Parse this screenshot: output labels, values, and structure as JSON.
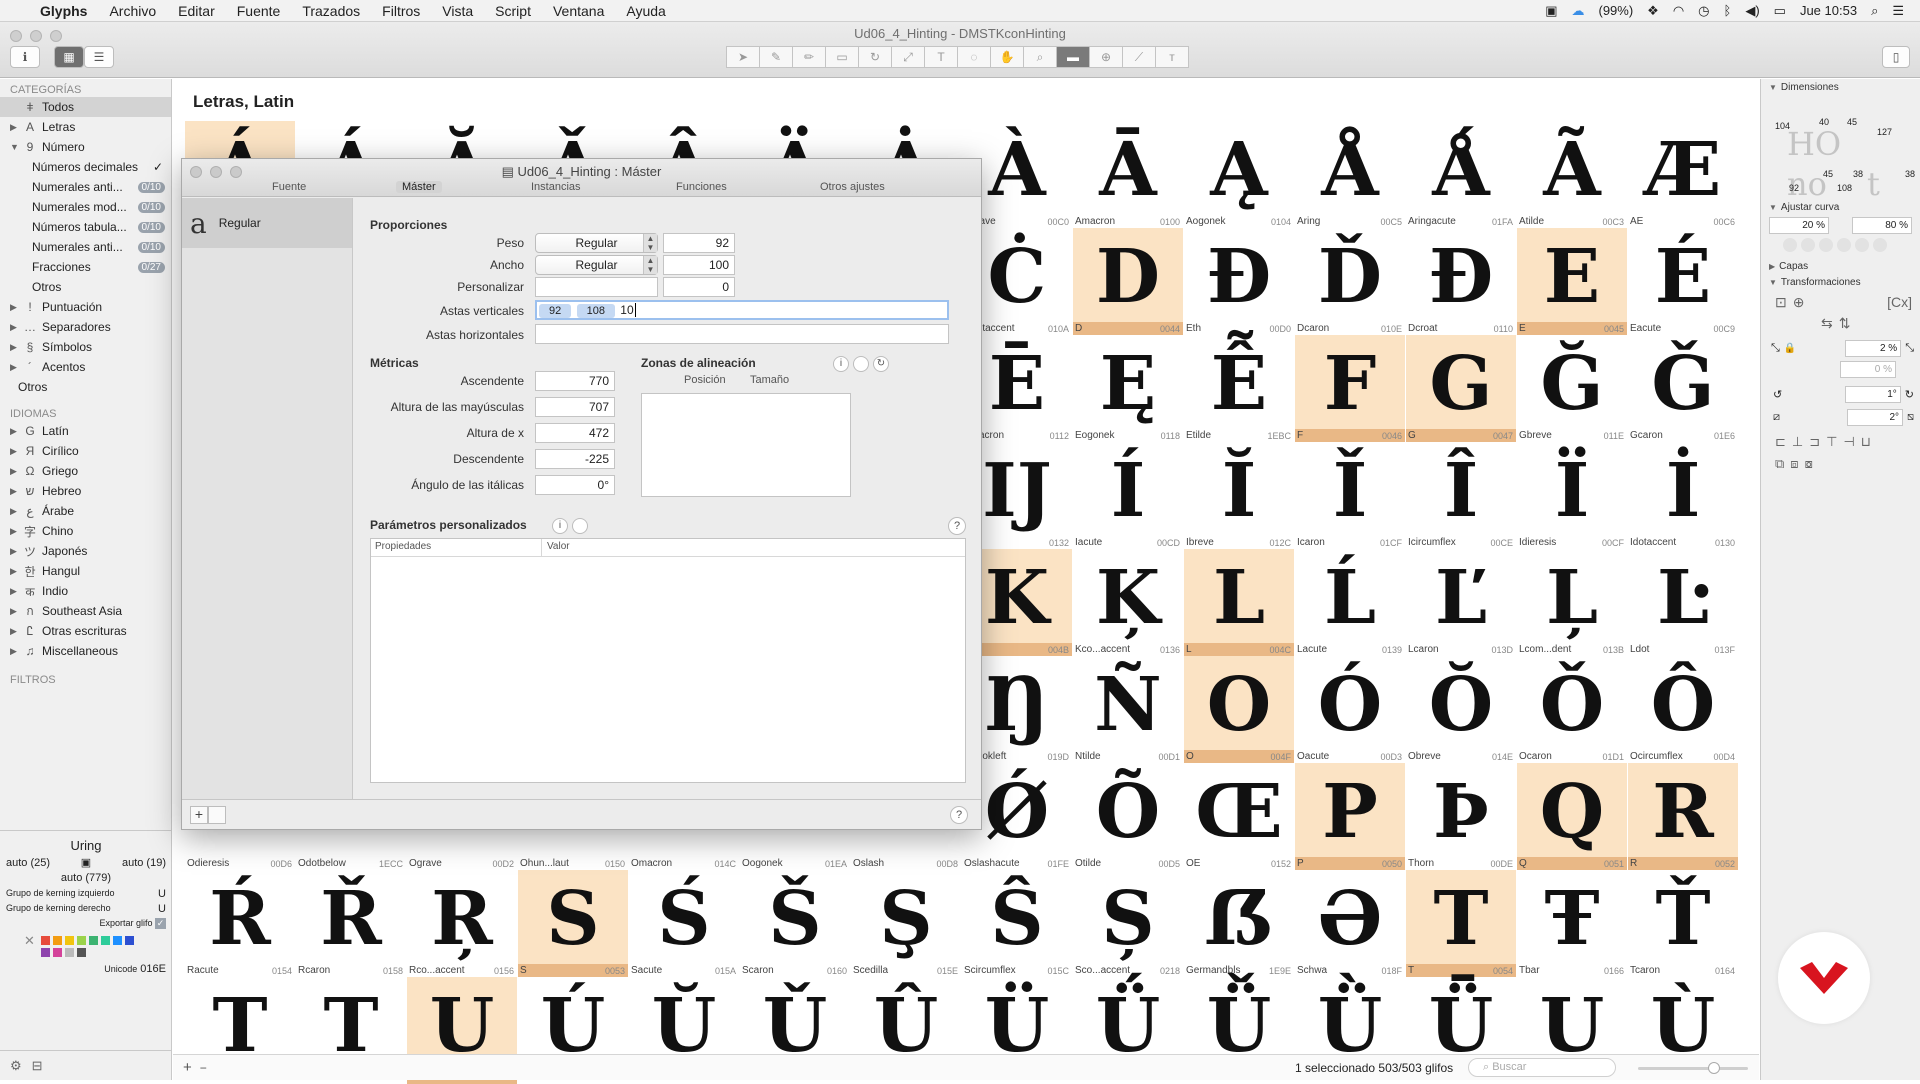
{
  "menubar": {
    "app": "Glyphs",
    "items": [
      "Archivo",
      "Editar",
      "Fuente",
      "Trazados",
      "Filtros",
      "Vista",
      "Script",
      "Ventana",
      "Ayuda"
    ],
    "battery": "(99%)",
    "clock": "Jue 10:53"
  },
  "window": {
    "title": "Ud06_4_Hinting - DMSTKconHinting"
  },
  "sidebar": {
    "categories_head": "CATEGORÍAS",
    "categories": [
      {
        "label": "Todos",
        "icon": "ǂ",
        "sel": true
      },
      {
        "label": "Letras",
        "icon": "A",
        "tri": "▶"
      },
      {
        "label": "Número",
        "icon": "9",
        "tri": "▼"
      }
    ],
    "number_sub": [
      {
        "label": "Números decimales",
        "badge": "✓"
      },
      {
        "label": "Numerales anti...",
        "count": "0/10"
      },
      {
        "label": "Numerales mod...",
        "count": "0/10"
      },
      {
        "label": "Números tabula...",
        "count": "0/10"
      },
      {
        "label": "Numerales anti...",
        "count": "0/10"
      },
      {
        "label": "Fracciones",
        "count": "0/27"
      },
      {
        "label": "Otros"
      }
    ],
    "categories_more": [
      {
        "label": "Puntuación",
        "icon": "!"
      },
      {
        "label": "Separadores",
        "icon": "…"
      },
      {
        "label": "Símbolos",
        "icon": "§"
      },
      {
        "label": "Acentos",
        "icon": "´"
      }
    ],
    "other_label": "Otros",
    "languages_head": "IDIOMAS",
    "languages": [
      {
        "label": "Latín",
        "icon": "G"
      },
      {
        "label": "Cirílico",
        "icon": "Я"
      },
      {
        "label": "Griego",
        "icon": "Ω"
      },
      {
        "label": "Hebreo",
        "icon": "ש"
      },
      {
        "label": "Árabe",
        "icon": "ع"
      },
      {
        "label": "Chino",
        "icon": "字"
      },
      {
        "label": "Japonés",
        "icon": "ツ"
      },
      {
        "label": "Hangul",
        "icon": "한"
      },
      {
        "label": "Indio",
        "icon": "क"
      },
      {
        "label": "Southeast Asia",
        "icon": "ก"
      },
      {
        "label": "Otras escrituras",
        "icon": "Ꮭ"
      },
      {
        "label": "Miscellaneous",
        "icon": "♫"
      }
    ],
    "filters_head": "FILTROS",
    "bottom": {
      "glyph_name": "Uring",
      "lsb": "auto (25)",
      "rsb": "auto (19)",
      "width": "auto (779)",
      "kern_left_label": "Grupo de kerning izquierdo",
      "kern_left_value": "U",
      "kern_right_label": "Grupo de kerning derecho",
      "kern_right_value": "U",
      "export_label": "Exportar glifo",
      "unicode_label": "Unicode",
      "unicode_value": "016E"
    },
    "swatch_colors": [
      "#e74c3c",
      "#f39c12",
      "#f1c40f",
      "#9bd34a",
      "#3cb371",
      "#2ecc9a",
      "#1e90ff",
      "#2c4fd1",
      "#8e44ad",
      "#d4439a",
      "#bbbbbb",
      "#555555"
    ]
  },
  "main": {
    "category_title": "Letras, Latin",
    "status": "1 seleccionado 503/503 glifos",
    "search_placeholder": "Buscar",
    "glyphs": [
      {
        "g": "Á",
        "name": "",
        "hl": true
      },
      {
        "g": "Á",
        "name": ""
      },
      {
        "g": "Ă",
        "name": ""
      },
      {
        "g": "Ǎ",
        "name": ""
      },
      {
        "g": "Â",
        "name": ""
      },
      {
        "g": "Ä",
        "name": ""
      },
      {
        "g": "Ȧ",
        "name": ""
      },
      {
        "g": "À",
        "name": "Agrave",
        "code": "00C0"
      },
      {
        "g": "Ā",
        "name": "Amacron",
        "code": "0100"
      },
      {
        "g": "Ą",
        "name": "Aogonek",
        "code": "0104"
      },
      {
        "g": "Å",
        "name": "Aring",
        "code": "00C5"
      },
      {
        "g": "Ǻ",
        "name": "Aringacute",
        "code": "01FA"
      },
      {
        "g": "Ã",
        "name": "Atilde",
        "code": "00C3"
      },
      {
        "g": "Æ",
        "name": "AE",
        "code": "00C6"
      },
      {
        "g": "",
        "name": ""
      },
      {
        "g": "",
        "name": ""
      },
      {
        "g": "",
        "name": ""
      },
      {
        "g": "",
        "name": ""
      },
      {
        "g": "",
        "name": ""
      },
      {
        "g": "",
        "name": ""
      },
      {
        "g": "",
        "name": ""
      },
      {
        "g": "Ċ",
        "name": "Cdotaccent",
        "code": "010A"
      },
      {
        "g": "D",
        "name": "D",
        "code": "0044",
        "hl": true
      },
      {
        "g": "Ð",
        "name": "Eth",
        "code": "00D0"
      },
      {
        "g": "Ď",
        "name": "Dcaron",
        "code": "010E"
      },
      {
        "g": "Đ",
        "name": "Dcroat",
        "code": "0110"
      },
      {
        "g": "E",
        "name": "E",
        "code": "0045",
        "hl": true
      },
      {
        "g": "É",
        "name": "Eacute",
        "code": "00C9"
      },
      {
        "g": "",
        "name": ""
      },
      {
        "g": "",
        "name": ""
      },
      {
        "g": "",
        "name": ""
      },
      {
        "g": "",
        "name": ""
      },
      {
        "g": "",
        "name": ""
      },
      {
        "g": "",
        "name": ""
      },
      {
        "g": "",
        "name": ""
      },
      {
        "g": "Ē",
        "name": "Emacron",
        "code": "0112"
      },
      {
        "g": "Ę",
        "name": "Eogonek",
        "code": "0118"
      },
      {
        "g": "Ễ",
        "name": "Etilde",
        "code": "1EBC"
      },
      {
        "g": "F",
        "name": "F",
        "code": "0046",
        "hl": true
      },
      {
        "g": "G",
        "name": "G",
        "code": "0047",
        "hl": true
      },
      {
        "g": "Ğ",
        "name": "Gbreve",
        "code": "011E"
      },
      {
        "g": "Ǧ",
        "name": "Gcaron",
        "code": "01E6"
      },
      {
        "g": "",
        "name": ""
      },
      {
        "g": "",
        "name": ""
      },
      {
        "g": "",
        "name": ""
      },
      {
        "g": "",
        "name": ""
      },
      {
        "g": "",
        "name": ""
      },
      {
        "g": "",
        "name": ""
      },
      {
        "g": "",
        "name": ""
      },
      {
        "g": "Ĳ",
        "name": "IJ",
        "code": "0132"
      },
      {
        "g": "Í",
        "name": "Iacute",
        "code": "00CD"
      },
      {
        "g": "Ĭ",
        "name": "Ibreve",
        "code": "012C"
      },
      {
        "g": "Ǐ",
        "name": "Icaron",
        "code": "01CF"
      },
      {
        "g": "Î",
        "name": "Icircumflex",
        "code": "00CE"
      },
      {
        "g": "Ï",
        "name": "Idieresis",
        "code": "00CF"
      },
      {
        "g": "İ",
        "name": "Idotaccent",
        "code": "0130"
      },
      {
        "g": "",
        "name": ""
      },
      {
        "g": "",
        "name": ""
      },
      {
        "g": "",
        "name": ""
      },
      {
        "g": "",
        "name": ""
      },
      {
        "g": "",
        "name": ""
      },
      {
        "g": "",
        "name": ""
      },
      {
        "g": "",
        "name": ""
      },
      {
        "g": "K",
        "name": "K",
        "code": "004B",
        "hl": true
      },
      {
        "g": "Ķ",
        "name": "Kco...accent",
        "code": "0136"
      },
      {
        "g": "L",
        "name": "L",
        "code": "004C",
        "hl": true
      },
      {
        "g": "Ĺ",
        "name": "Lacute",
        "code": "0139"
      },
      {
        "g": "Ľ",
        "name": "Lcaron",
        "code": "013D"
      },
      {
        "g": "Ļ",
        "name": "Lcom...dent",
        "code": "013B"
      },
      {
        "g": "Ŀ",
        "name": "Ldot",
        "code": "013F"
      },
      {
        "g": "",
        "name": ""
      },
      {
        "g": "",
        "name": ""
      },
      {
        "g": "",
        "name": ""
      },
      {
        "g": "",
        "name": ""
      },
      {
        "g": "",
        "name": ""
      },
      {
        "g": "",
        "name": ""
      },
      {
        "g": "",
        "name": ""
      },
      {
        "g": "Ŋ",
        "name": "Nhookleft",
        "code": "019D"
      },
      {
        "g": "Ñ",
        "name": "Ntilde",
        "code": "00D1"
      },
      {
        "g": "O",
        "name": "O",
        "code": "004F",
        "hl": true
      },
      {
        "g": "Ó",
        "name": "Oacute",
        "code": "00D3"
      },
      {
        "g": "Ŏ",
        "name": "Obreve",
        "code": "014E"
      },
      {
        "g": "Ǒ",
        "name": "Ocaron",
        "code": "01D1"
      },
      {
        "g": "Ô",
        "name": "Ocircumflex",
        "code": "00D4"
      },
      {
        "g": "",
        "name": "Odieresis",
        "code": "00D6"
      },
      {
        "g": "",
        "name": "Odotbelow",
        "code": "1ECC"
      },
      {
        "g": "",
        "name": "Ograve",
        "code": "00D2"
      },
      {
        "g": "",
        "name": "Ohun...laut",
        "code": "0150"
      },
      {
        "g": "",
        "name": "Omacron",
        "code": "014C"
      },
      {
        "g": "",
        "name": "Oogonek",
        "code": "01EA"
      },
      {
        "g": "",
        "name": "Oslash",
        "code": "00D8"
      },
      {
        "g": "Ǿ",
        "name": "Oslashacute",
        "code": "01FE"
      },
      {
        "g": "Õ",
        "name": "Otilde",
        "code": "00D5"
      },
      {
        "g": "Œ",
        "name": "OE",
        "code": "0152"
      },
      {
        "g": "P",
        "name": "P",
        "code": "0050",
        "hl": true
      },
      {
        "g": "Þ",
        "name": "Thorn",
        "code": "00DE"
      },
      {
        "g": "Q",
        "name": "Q",
        "code": "0051",
        "hl": true
      },
      {
        "g": "R",
        "name": "R",
        "code": "0052",
        "hl": true
      },
      {
        "g": "Ŕ",
        "name": "Racute",
        "code": "0154"
      },
      {
        "g": "Ř",
        "name": "Rcaron",
        "code": "0158"
      },
      {
        "g": "Ŗ",
        "name": "Rco...accent",
        "code": "0156"
      },
      {
        "g": "S",
        "name": "S",
        "code": "0053",
        "hl": true
      },
      {
        "g": "Ś",
        "name": "Sacute",
        "code": "015A"
      },
      {
        "g": "Š",
        "name": "Scaron",
        "code": "0160"
      },
      {
        "g": "Ş",
        "name": "Scedilla",
        "code": "015E"
      },
      {
        "g": "Ŝ",
        "name": "Scircumflex",
        "code": "015C"
      },
      {
        "g": "Ș",
        "name": "Sco...accent",
        "code": "0218"
      },
      {
        "g": "ẞ",
        "name": "Germandbls",
        "code": "1E9E"
      },
      {
        "g": "Ə",
        "name": "Schwa",
        "code": "018F"
      },
      {
        "g": "T",
        "name": "T",
        "code": "0054",
        "hl": true
      },
      {
        "g": "Ŧ",
        "name": "Tbar",
        "code": "0166"
      },
      {
        "g": "Ť",
        "name": "Tcaron",
        "code": "0164"
      },
      {
        "g": "T",
        "name": ""
      },
      {
        "g": "T",
        "name": ""
      },
      {
        "g": "U",
        "name": "",
        "hl": true
      },
      {
        "g": "Ú",
        "name": ""
      },
      {
        "g": "Ŭ",
        "name": ""
      },
      {
        "g": "Ǔ",
        "name": ""
      },
      {
        "g": "Û",
        "name": ""
      },
      {
        "g": "Ü",
        "name": ""
      },
      {
        "g": "Ǘ",
        "name": ""
      },
      {
        "g": "Ǚ",
        "name": ""
      },
      {
        "g": "Ǜ",
        "name": ""
      },
      {
        "g": "Ǖ",
        "name": ""
      },
      {
        "g": "U",
        "name": ""
      },
      {
        "g": "Ù",
        "name": ""
      }
    ]
  },
  "inspector": {
    "dimensions": "Dimensiones",
    "dim_values": [
      "104",
      "40",
      "45",
      "127",
      "45",
      "38",
      "38",
      "92",
      "108"
    ],
    "adjust_curve": "Ajustar curva",
    "curve_a": "20 %",
    "curve_b": "80 %",
    "layers": "Capas",
    "transform": "Transformaciones",
    "scale": "2 %",
    "scale_b": "0 %",
    "rotate": "1°",
    "slant": "2°"
  },
  "dialog": {
    "title": "Ud06_4_Hinting : Máster",
    "tabs": [
      "Fuente",
      "Máster",
      "Instancias",
      "Funciones",
      "Otros ajustes"
    ],
    "master_name": "Regular",
    "master_glyph": "a",
    "proportions": "Proporciones",
    "weight_label": "Peso",
    "weight_value": "Regular",
    "weight_num": "92",
    "width_label": "Ancho",
    "width_value": "Regular",
    "width_num": "100",
    "custom_label": "Personalizar",
    "custom_num": "0",
    "vstems_label": "Astas verticales",
    "vstems": [
      "92",
      "108"
    ],
    "vstems_typing": "10",
    "hstems_label": "Astas horizontales",
    "metrics": "Métricas",
    "ascender_label": "Ascendente",
    "ascender": "770",
    "capheight_label": "Altura de las mayúsculas",
    "capheight": "707",
    "xheight_label": "Altura de x",
    "xheight": "472",
    "descender_label": "Descendente",
    "descender": "-225",
    "italic_label": "Ángulo de las itálicas",
    "italic": "0°",
    "align_zones": "Zonas de alineación",
    "position": "Posición",
    "size": "Tamaño",
    "custom_params": "Parámetros personalizados",
    "col_props": "Propiedades",
    "col_value": "Valor"
  },
  "logo_color": "#d8141f"
}
